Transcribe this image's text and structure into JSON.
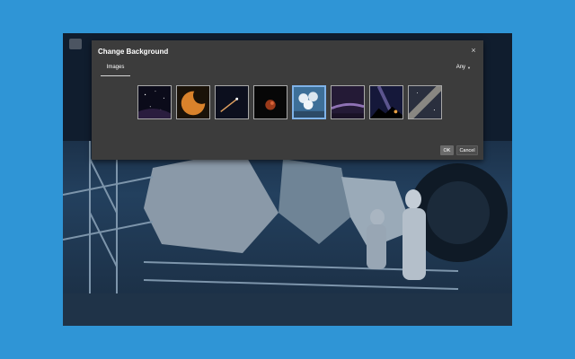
{
  "dialog": {
    "title": "Change Background",
    "close_label": "×",
    "tab_label": "Images",
    "filter_value": "Any",
    "ok_label": "OK",
    "cancel_label": "Cancel"
  },
  "thumbnails": [
    {
      "name": "starry-sky",
      "selected": false
    },
    {
      "name": "partial-solar-eclipse",
      "selected": false
    },
    {
      "name": "comet",
      "selected": false
    },
    {
      "name": "lunar-eclipse",
      "selected": false
    },
    {
      "name": "radio-telescope-dishes",
      "selected": true
    },
    {
      "name": "galaxy-horizon",
      "selected": false
    },
    {
      "name": "milky-way-mountains",
      "selected": false
    },
    {
      "name": "milky-way-core",
      "selected": false
    }
  ],
  "colors": {
    "page_background": "#2f95d6",
    "dialog_background": "#3c3c3c",
    "selection_border": "#7fb2e8"
  }
}
